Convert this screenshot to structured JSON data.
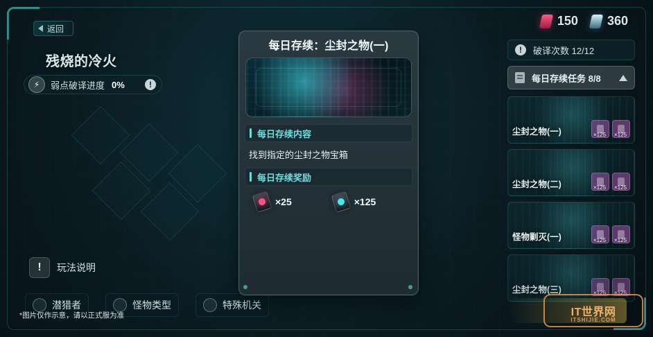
{
  "top_left": {
    "back_label": "返回",
    "stage_title": "残烧的冷火",
    "weakness_progress_label": "弱点破译进度",
    "weakness_progress_value": "0%",
    "help_label": "玩法说明"
  },
  "currencies": [
    {
      "icon": "pink-crystal-icon",
      "value": "150"
    },
    {
      "icon": "white-crystal-icon",
      "value": "360"
    }
  ],
  "right_panel": {
    "decrypt_count_label": "破译次数 12/12",
    "daily_tasks_label": "每日存续任务 8/8",
    "tasks": [
      {
        "name": "尘封之物(一)",
        "mini_values": [
          "×125",
          "×125"
        ]
      },
      {
        "name": "尘封之物(二)",
        "mini_values": [
          "×125",
          "×125"
        ]
      },
      {
        "name": "怪物剿灭(一)",
        "mini_values": [
          "×125",
          "×125"
        ]
      },
      {
        "name": "尘封之物(三)",
        "mini_values": [
          "×125",
          "×125"
        ]
      }
    ]
  },
  "modal": {
    "title": "每日存续：尘封之物(一)",
    "section_content_title": "每日存续内容",
    "section_content_text": "找到指定的尘封之物宝箱",
    "section_rewards_title": "每日存续奖励",
    "rewards": [
      {
        "icon": "pink-token-icon",
        "count": "×25"
      },
      {
        "icon": "cyan-token-icon",
        "count": "×125"
      }
    ]
  },
  "bottom_tabs": [
    {
      "label": "潜猎者"
    },
    {
      "label": "怪物类型"
    },
    {
      "label": "特殊机关"
    }
  ],
  "disclaimer": "*图片仅作示意，请以正式服为准",
  "watermark": {
    "main": "IT世界网",
    "sub": "ITSHIJIE.COM"
  }
}
